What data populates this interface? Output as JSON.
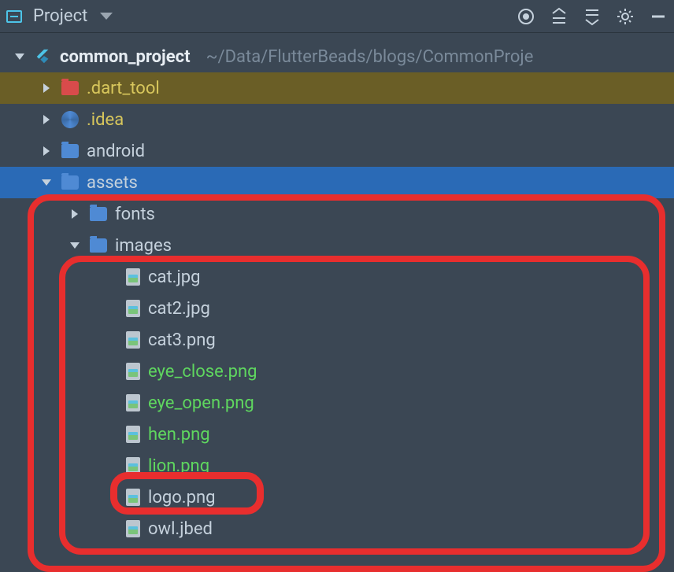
{
  "toolbar": {
    "project_label": "Project"
  },
  "tree": {
    "root": {
      "name": "common_project",
      "path": "~/Data/FlutterBeads/blogs/CommonProje"
    },
    "dart_tool": ".dart_tool",
    "idea": ".idea",
    "android": "android",
    "assets": "assets",
    "fonts": "fonts",
    "images": "images",
    "files": {
      "cat": "cat.jpg",
      "cat2": "cat2.jpg",
      "cat3": "cat3.png",
      "eye_close": "eye_close.png",
      "eye_open": "eye_open.png",
      "hen": "hen.png",
      "lion": "lion.png",
      "logo": "logo.png",
      "owl": "owl.jbed"
    }
  }
}
